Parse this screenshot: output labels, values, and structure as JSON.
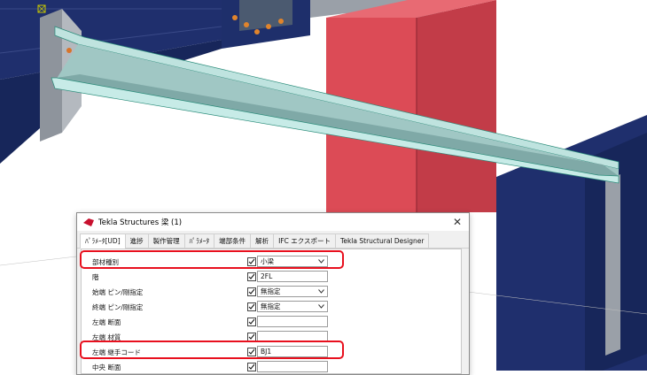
{
  "dialog": {
    "title": "Tekla Structures  梁 (1)",
    "close_glyph": "✕",
    "tabs": [
      {
        "label": "ﾊﾟﾗﾒｰﾀ[UD]"
      },
      {
        "label": "進捗"
      },
      {
        "label": "製作管理"
      },
      {
        "label": "ﾊﾟﾗﾒｰﾀ"
      },
      {
        "label": "端部条件"
      },
      {
        "label": "解析"
      },
      {
        "label": "IFC エクスポート"
      },
      {
        "label": "Tekla Structural Designer"
      }
    ],
    "rows": [
      {
        "label": "部材種別",
        "value": "小梁",
        "type": "select"
      },
      {
        "label": "階",
        "value": "2FL",
        "type": "text"
      },
      {
        "label": "始端 ピン/剛指定",
        "value": "無指定",
        "type": "select"
      },
      {
        "label": "終端 ピン/剛指定",
        "value": "無指定",
        "type": "select"
      },
      {
        "label": "左端 断面",
        "value": "",
        "type": "text"
      },
      {
        "label": "左端 材質",
        "value": "",
        "type": "text"
      },
      {
        "label": "左端 継手コード",
        "value": "BJ1",
        "type": "text"
      },
      {
        "label": "中央 断面",
        "value": "",
        "type": "text"
      }
    ]
  },
  "colors": {
    "beam_blue": "#1e2f6b",
    "column_red": "#d9434f",
    "selected_beam": "#9cc3c3",
    "highlight": "#e8101e"
  }
}
